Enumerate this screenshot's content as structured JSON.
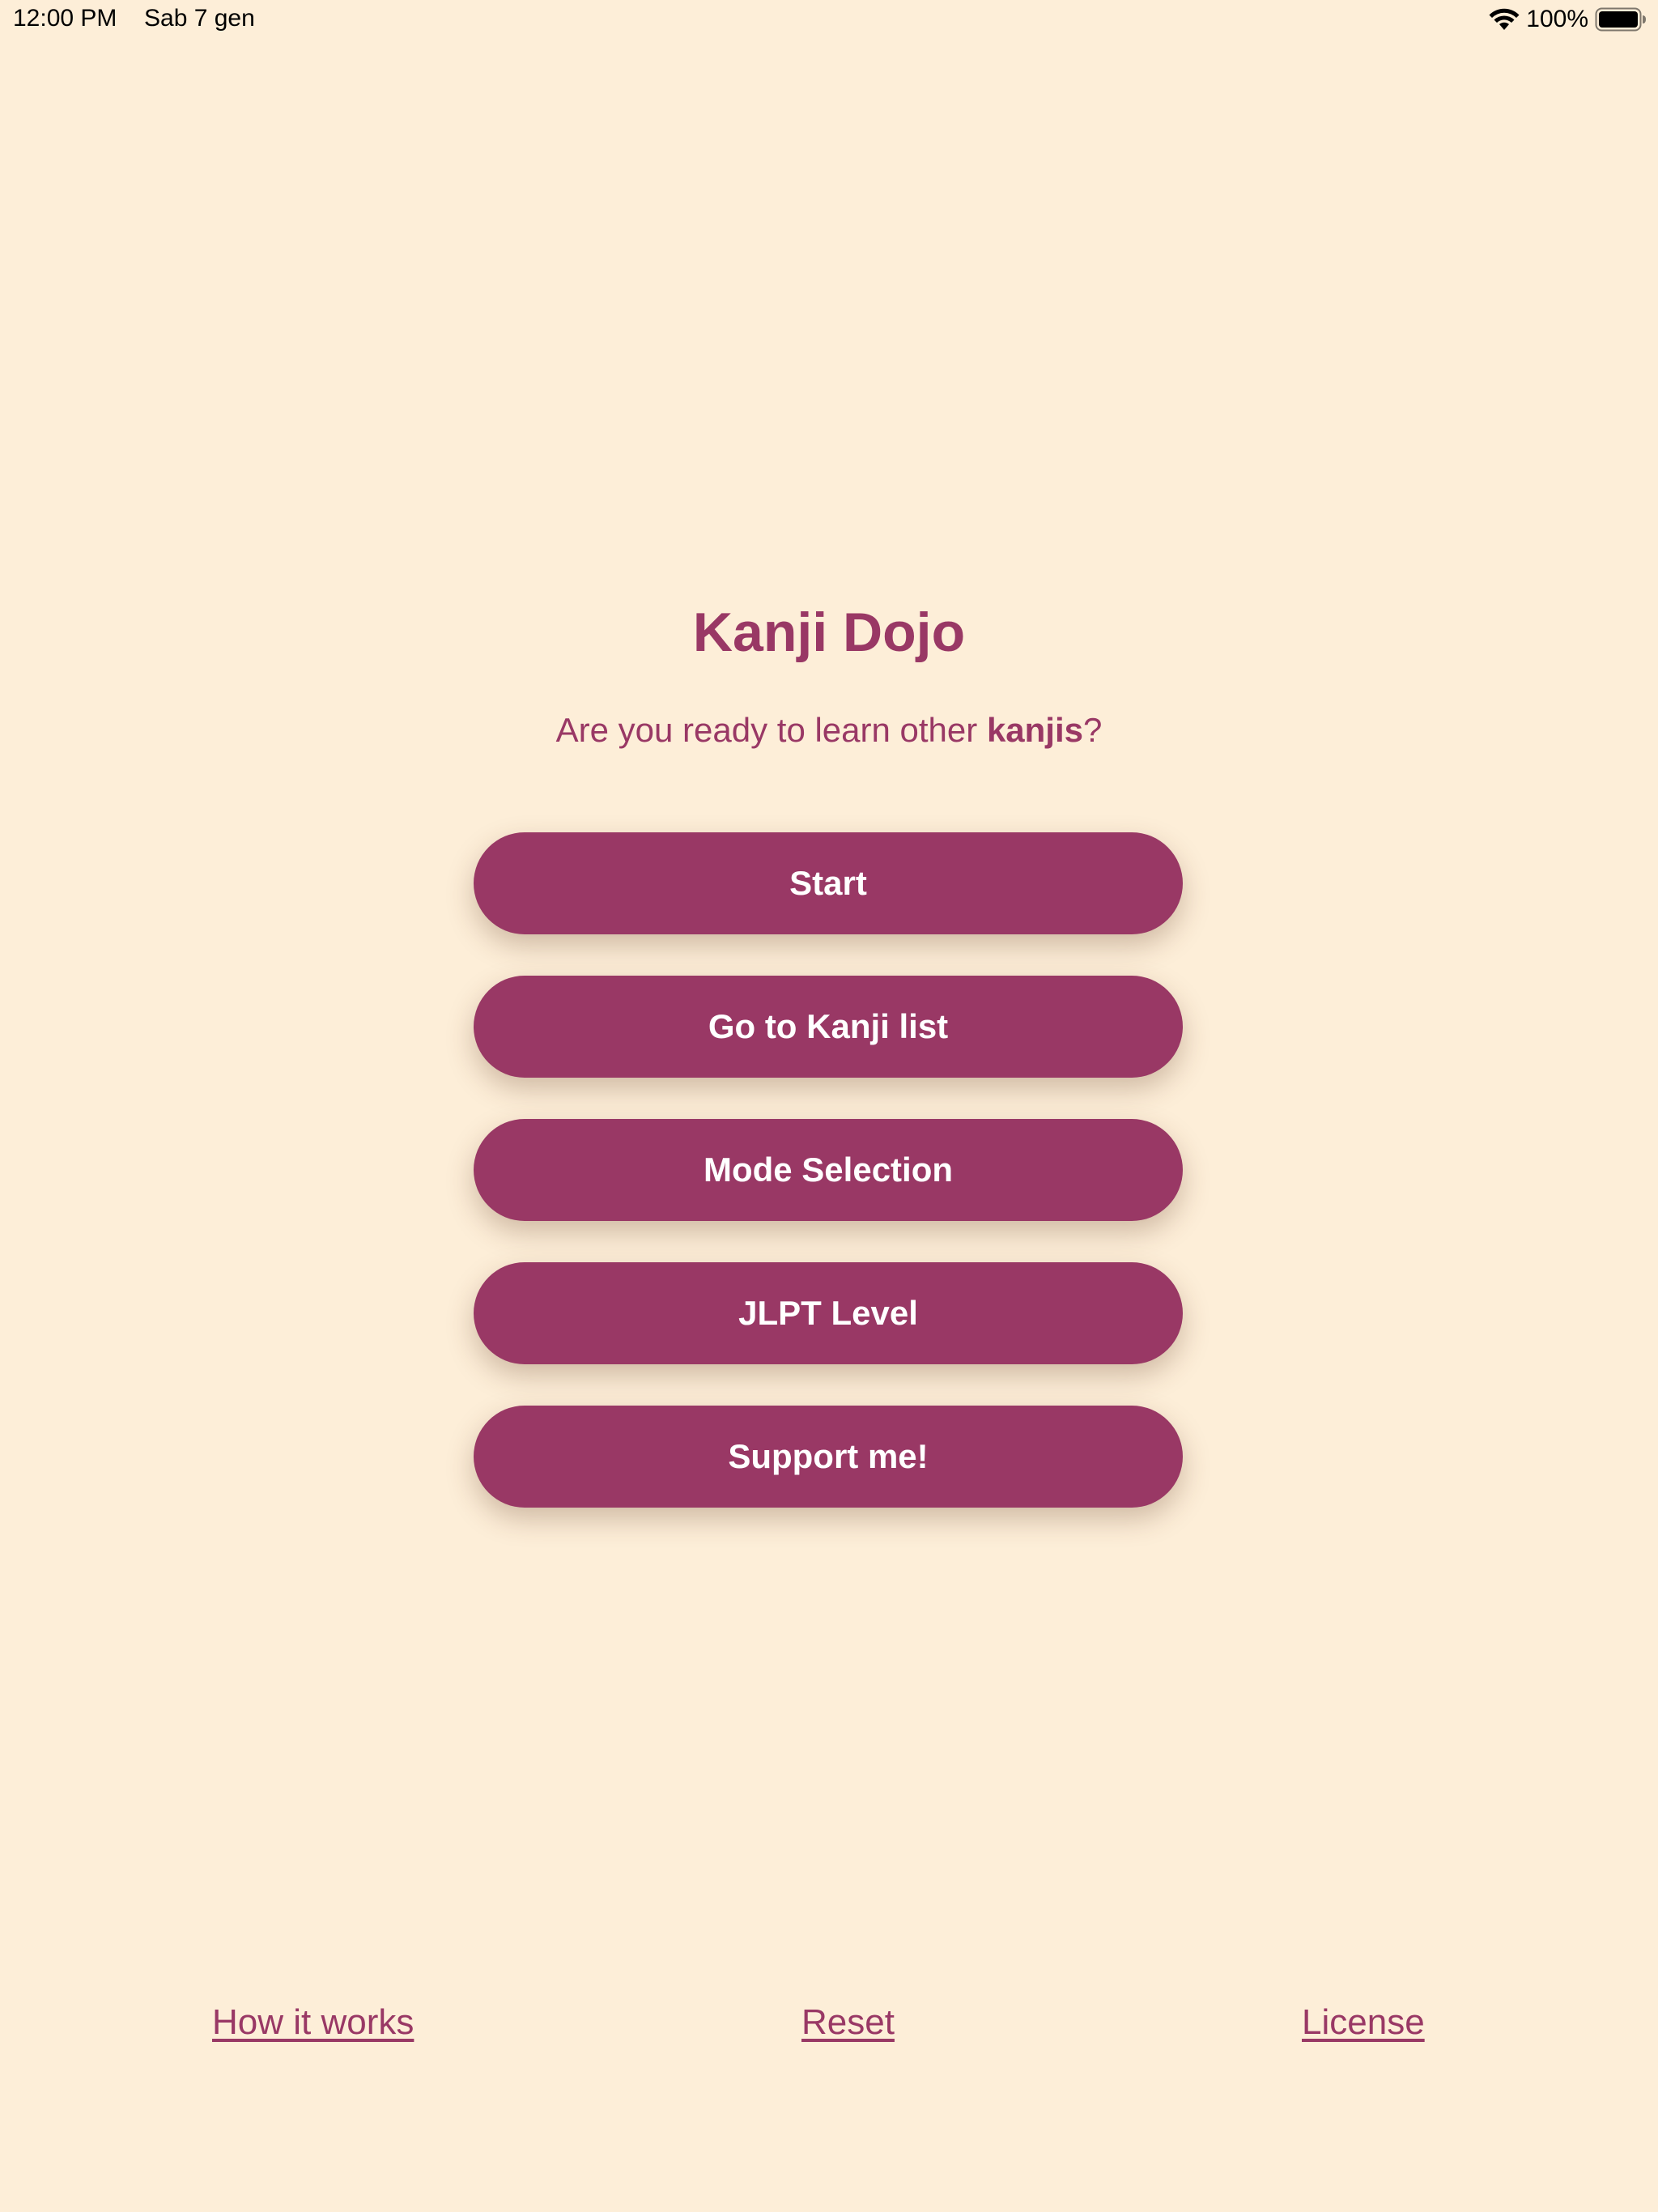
{
  "status_bar": {
    "time": "12:00 PM",
    "date": "Sab 7 gen",
    "battery_percent": "100%",
    "icons": [
      "wifi-icon",
      "battery-icon"
    ]
  },
  "main": {
    "title": "Kanji Dojo",
    "subtitle_prefix": "Are you ready to learn other ",
    "subtitle_bold": "kanjis",
    "subtitle_suffix": "?",
    "buttons": [
      {
        "label": "Start"
      },
      {
        "label": "Go to Kanji list"
      },
      {
        "label": "Mode Selection"
      },
      {
        "label": "JLPT Level"
      },
      {
        "label": "Support me!"
      }
    ]
  },
  "footer": {
    "how_it_works": "How it works",
    "reset": "Reset",
    "license": "License"
  },
  "colors": {
    "background": "#FDEED8",
    "accent": "#993865",
    "button_text": "#FFFFFF"
  }
}
